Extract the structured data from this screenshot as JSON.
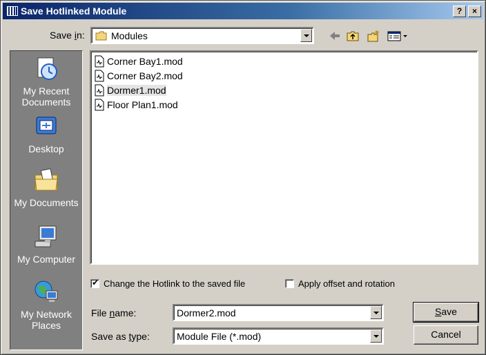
{
  "window": {
    "title": "Save Hotlinked Module"
  },
  "titlebar_buttons": {
    "help": "?",
    "close": "×"
  },
  "save_in": {
    "label_pre": "Save ",
    "label_u": "i",
    "label_post": "n:",
    "value": "Modules"
  },
  "places": [
    {
      "label": "My Recent Documents",
      "icon": "recent-documents-icon"
    },
    {
      "label": "Desktop",
      "icon": "desktop-icon"
    },
    {
      "label": "My Documents",
      "icon": "my-documents-icon"
    },
    {
      "label": "My Computer",
      "icon": "my-computer-icon"
    },
    {
      "label": "My Network Places",
      "icon": "network-places-icon"
    }
  ],
  "files": [
    {
      "name": "Corner Bay1.mod",
      "selected": false
    },
    {
      "name": "Corner Bay2.mod",
      "selected": false
    },
    {
      "name": "Dormer1.mod",
      "selected": true
    },
    {
      "name": "Floor Plan1.mod",
      "selected": false
    }
  ],
  "options": {
    "change_hotlink": {
      "label": "Change the Hotlink to the saved file",
      "checked": true
    },
    "apply_offset": {
      "label": "Apply offset and rotation",
      "checked": false
    }
  },
  "file_name": {
    "label_pre": "File ",
    "label_u": "n",
    "label_post": "ame:",
    "value": "Dormer2.mod"
  },
  "save_as_type": {
    "label_pre": "Save as ",
    "label_u": "t",
    "label_post": "ype:",
    "value": "Module File (*.mod)"
  },
  "buttons": {
    "save": "Save",
    "save_u": "S",
    "save_rest": "ave",
    "cancel": "Cancel"
  },
  "colors": {
    "title_start": "#0a246a",
    "title_end": "#a6caf0",
    "face": "#d4d0c8",
    "sidebar": "#808080"
  }
}
